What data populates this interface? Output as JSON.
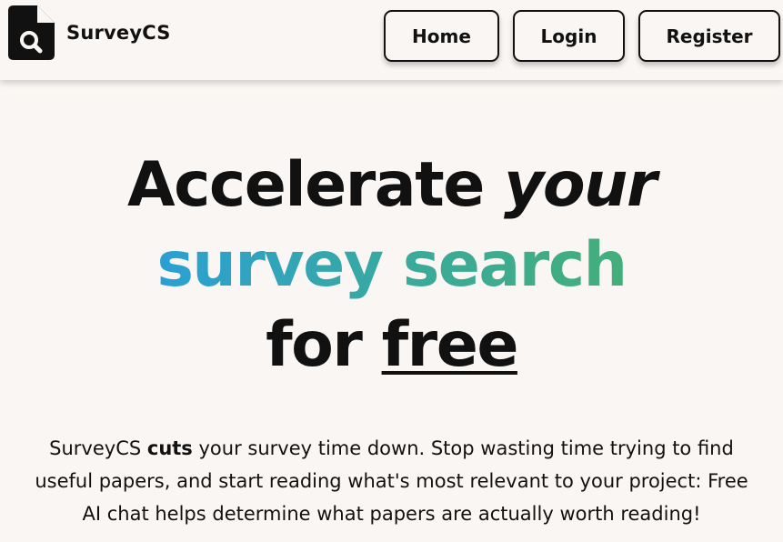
{
  "brand": {
    "name": "SurveyCS",
    "icon": "document-search-icon"
  },
  "nav": {
    "home_label": "Home",
    "login_label": "Login",
    "register_label": "Register"
  },
  "hero": {
    "line1_plain": "Accelerate ",
    "line1_italic": "your",
    "line2_word1": "survey",
    "line2_space": " ",
    "line2_word2": "search",
    "line3_plain": "for ",
    "line3_underlined": "free"
  },
  "description": {
    "part1": "SurveyCS ",
    "bold": "cuts",
    "part2": " your survey time down. Stop wasting time trying to find useful papers, and start reading what's most relevant to your project: Free AI chat helps determine what papers are actually worth reading!"
  },
  "colors": {
    "background": "#faf6f3",
    "gradient_start": "#2aa0d4",
    "gradient_end": "#44ae7a",
    "text": "#111111"
  }
}
